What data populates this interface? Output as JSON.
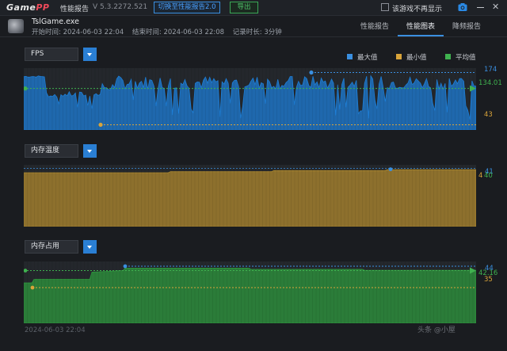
{
  "app": {
    "logo_game": "Game",
    "logo_pp": "PP",
    "title": "性能报告",
    "version": "V 5.3.2272.521",
    "switch_button": "切换至性能报告2.0",
    "export_button": "导出",
    "dont_show_label": "该游戏不再显示"
  },
  "game": {
    "name": "TslGame.exe",
    "start_time": "开始时间: 2024-06-03 22:04",
    "end_time": "结束时间: 2024-06-03 22:08",
    "duration": "记录时长: 3分钟"
  },
  "tabs": [
    {
      "label": "性能报告",
      "active": false
    },
    {
      "label": "性能图表",
      "active": true
    },
    {
      "label": "降频报告",
      "active": false
    }
  ],
  "legend": [
    {
      "label": "最大值",
      "color": "#3a8fe0"
    },
    {
      "label": "最小值",
      "color": "#d9a43a"
    },
    {
      "label": "平均值",
      "color": "#3fb24f"
    }
  ],
  "chart_data": [
    {
      "type": "area",
      "selector": "FPS",
      "color": "#1e7fd8",
      "max": "174",
      "min": "43",
      "avg": "134.01",
      "ylim": [
        30,
        185
      ]
    },
    {
      "type": "area",
      "selector": "内存温度",
      "color": "#b08a2e",
      "max_label": "41",
      "avg_label": "40",
      "min_label": "4",
      "ylim": [
        0,
        43
      ]
    },
    {
      "type": "area",
      "selector": "内存占用",
      "color": "#2e9a3e",
      "max": "44",
      "avg": "42.16",
      "min": "35",
      "ylim": [
        20,
        46
      ]
    }
  ],
  "footer": {
    "time": "2024-06-03 22:04",
    "watermark": "头条 @小屋"
  }
}
